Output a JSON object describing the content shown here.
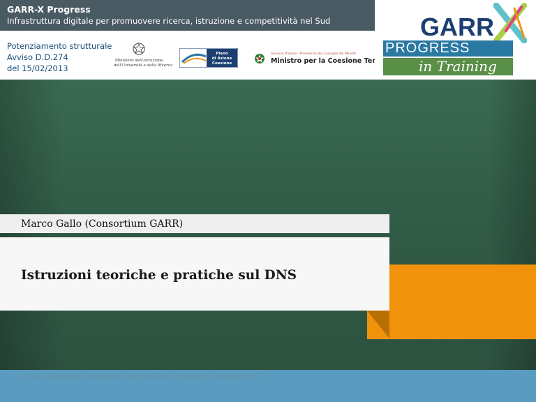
{
  "header": {
    "title": "GARR-X Progress",
    "subtitle": "Infrastruttura digitale per promuovere ricerca, istruzione e competitività nel Sud"
  },
  "funding": {
    "line1": "Potenziamento strutturale",
    "line2": "Avviso D.D.274",
    "line3": "del 15/02/2013"
  },
  "logos": {
    "miur_line1": "Ministero dell'Istruzione",
    "miur_line2": "dell'Università e della Ricerca",
    "pac_text": "Piano di Azione Coesione",
    "ministro_small": "Governo Italiano - Presidenza del Consiglio dei Ministri",
    "ministro_name": "Ministro per la Coesione Territoriale"
  },
  "brand": {
    "word": "GARR",
    "progress": "PROGRESS",
    "training": "in Training",
    "colors": {
      "navy": "#1c3f72",
      "blue": "#2a79a3",
      "green": "#5a8f48",
      "orange": "#f0930a"
    }
  },
  "slide": {
    "author": "Marco Gallo (Consortium GARR)",
    "title": "Istruzioni teoriche e pratiche sul DNS",
    "footer": "Corsi Intensivi dedicati agli APM, Catania, 19/06/2015"
  }
}
